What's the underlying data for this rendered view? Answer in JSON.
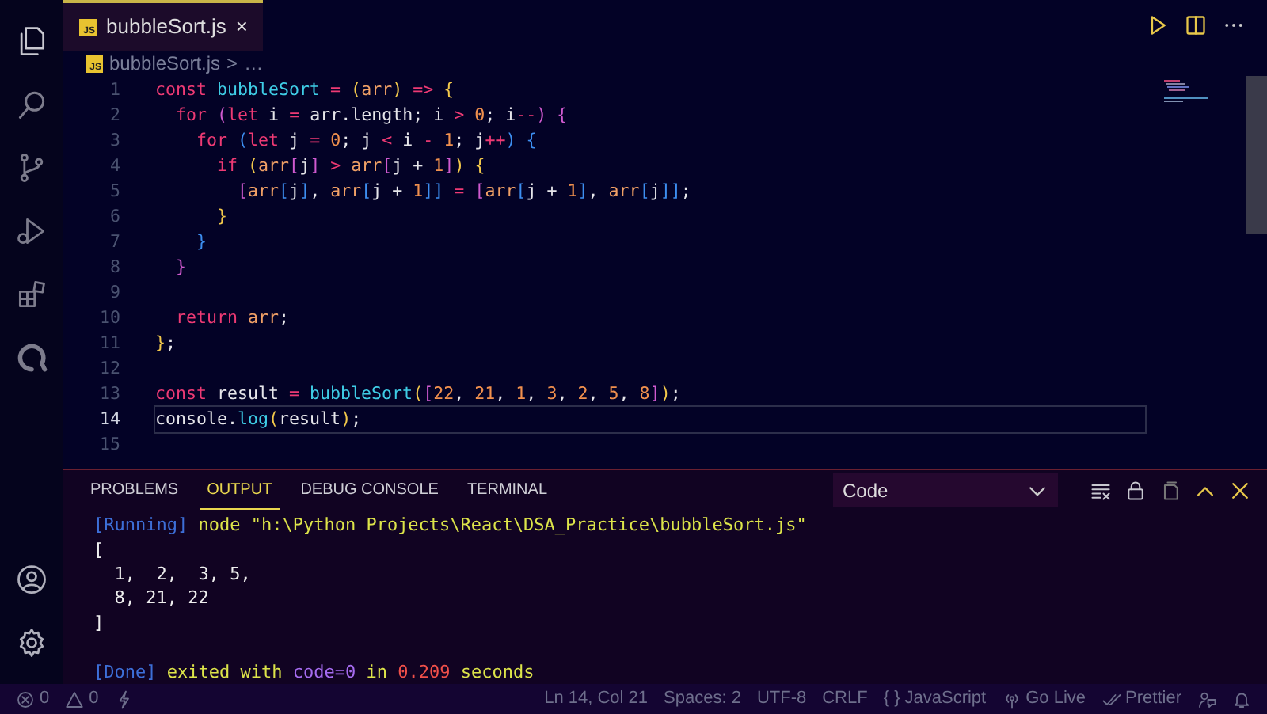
{
  "activity_bar": {
    "top": [
      {
        "kind": "files",
        "selected": true
      },
      {
        "kind": "search",
        "selected": false
      },
      {
        "kind": "branch",
        "selected": false
      },
      {
        "kind": "debug",
        "selected": false
      },
      {
        "kind": "extensions",
        "selected": false
      },
      {
        "kind": "quokka",
        "selected": false
      }
    ],
    "bottom": [
      {
        "kind": "account"
      },
      {
        "kind": "gear"
      }
    ]
  },
  "tabs": [
    {
      "badge": "JS",
      "label": "bubbleSort.js",
      "close": "×",
      "selected": true
    }
  ],
  "editor_actions": [
    {
      "kind": "run"
    },
    {
      "kind": "split"
    },
    {
      "kind": "more"
    }
  ],
  "breadcrumb": {
    "badge": "JS",
    "file": "bubbleSort.js",
    "separator": ">",
    "rest": "…"
  },
  "code": [
    {
      "number": "1",
      "current": false,
      "tokens": [
        {
          "text": "const ",
          "kind": "kw"
        },
        {
          "text": "bubbleSort",
          "kind": "fn"
        },
        {
          "text": " = ",
          "kind": "op"
        },
        {
          "text": "(",
          "kind": "b1"
        },
        {
          "text": "arr",
          "kind": "param"
        },
        {
          "text": ")",
          "kind": "b1"
        },
        {
          "text": " => ",
          "kind": "op"
        },
        {
          "text": "{",
          "kind": "b1"
        }
      ]
    },
    {
      "number": "2",
      "current": false,
      "tokens": [
        {
          "text": "  for ",
          "kind": "kw"
        },
        {
          "text": "(",
          "kind": "b2"
        },
        {
          "text": "let ",
          "kind": "kw"
        },
        {
          "text": "i ",
          "kind": "text"
        },
        {
          "text": "= ",
          "kind": "op"
        },
        {
          "text": "arr.length; i ",
          "kind": "text"
        },
        {
          "text": "> ",
          "kind": "op"
        },
        {
          "text": "0",
          "kind": "num"
        },
        {
          "text": "; i",
          "kind": "text"
        },
        {
          "text": "--",
          "kind": "op"
        },
        {
          "text": ")",
          "kind": "b2"
        },
        {
          "text": " {",
          "kind": "b2"
        }
      ]
    },
    {
      "number": "3",
      "current": false,
      "tokens": [
        {
          "text": "    for ",
          "kind": "kw"
        },
        {
          "text": "(",
          "kind": "b3"
        },
        {
          "text": "let ",
          "kind": "kw"
        },
        {
          "text": "j ",
          "kind": "text"
        },
        {
          "text": "= ",
          "kind": "op"
        },
        {
          "text": "0",
          "kind": "num"
        },
        {
          "text": "; j ",
          "kind": "text"
        },
        {
          "text": "< ",
          "kind": "op"
        },
        {
          "text": "i ",
          "kind": "text"
        },
        {
          "text": "- ",
          "kind": "op"
        },
        {
          "text": "1",
          "kind": "num"
        },
        {
          "text": "; j",
          "kind": "text"
        },
        {
          "text": "++",
          "kind": "op"
        },
        {
          "text": ")",
          "kind": "b3"
        },
        {
          "text": " {",
          "kind": "b3"
        }
      ]
    },
    {
      "number": "4",
      "current": false,
      "tokens": [
        {
          "text": "      if ",
          "kind": "kw"
        },
        {
          "text": "(",
          "kind": "b1"
        },
        {
          "text": "arr",
          "kind": "param"
        },
        {
          "text": "[",
          "kind": "b2"
        },
        {
          "text": "j",
          "kind": "text"
        },
        {
          "text": "]",
          "kind": "b2"
        },
        {
          "text": " > ",
          "kind": "op"
        },
        {
          "text": "arr",
          "kind": "param"
        },
        {
          "text": "[",
          "kind": "b2"
        },
        {
          "text": "j + ",
          "kind": "text"
        },
        {
          "text": "1",
          "kind": "num"
        },
        {
          "text": "]",
          "kind": "b2"
        },
        {
          "text": ")",
          "kind": "b1"
        },
        {
          "text": " {",
          "kind": "b1"
        }
      ]
    },
    {
      "number": "5",
      "current": false,
      "tokens": [
        {
          "text": "        [",
          "kind": "b2"
        },
        {
          "text": "arr",
          "kind": "param"
        },
        {
          "text": "[",
          "kind": "b3"
        },
        {
          "text": "j",
          "kind": "text"
        },
        {
          "text": "]",
          "kind": "b3"
        },
        {
          "text": ", ",
          "kind": "text"
        },
        {
          "text": "arr",
          "kind": "param"
        },
        {
          "text": "[",
          "kind": "b3"
        },
        {
          "text": "j + ",
          "kind": "text"
        },
        {
          "text": "1",
          "kind": "num"
        },
        {
          "text": "]]",
          "kind": "b3"
        },
        {
          "text": " = ",
          "kind": "op"
        },
        {
          "text": "[",
          "kind": "b2"
        },
        {
          "text": "arr",
          "kind": "param"
        },
        {
          "text": "[",
          "kind": "b3"
        },
        {
          "text": "j + ",
          "kind": "text"
        },
        {
          "text": "1",
          "kind": "num"
        },
        {
          "text": "]",
          "kind": "b3"
        },
        {
          "text": ", ",
          "kind": "text"
        },
        {
          "text": "arr",
          "kind": "param"
        },
        {
          "text": "[",
          "kind": "b3"
        },
        {
          "text": "j",
          "kind": "text"
        },
        {
          "text": "]]",
          "kind": "b3"
        },
        {
          "text": ";",
          "kind": "text"
        }
      ]
    },
    {
      "number": "6",
      "current": false,
      "tokens": [
        {
          "text": "      }",
          "kind": "b1"
        }
      ]
    },
    {
      "number": "7",
      "current": false,
      "tokens": [
        {
          "text": "    }",
          "kind": "b3"
        }
      ]
    },
    {
      "number": "8",
      "current": false,
      "tokens": [
        {
          "text": "  }",
          "kind": "b2"
        }
      ]
    },
    {
      "number": "9",
      "current": false
    },
    {
      "number": "10",
      "current": false,
      "tokens": [
        {
          "text": "  return ",
          "kind": "kw"
        },
        {
          "text": "arr",
          "kind": "param"
        },
        {
          "text": ";",
          "kind": "text"
        }
      ]
    },
    {
      "number": "11",
      "current": false,
      "tokens": [
        {
          "text": "}",
          "kind": "b1"
        },
        {
          "text": ";",
          "kind": "text"
        }
      ]
    },
    {
      "number": "12",
      "current": false
    },
    {
      "number": "13",
      "current": false,
      "tokens": [
        {
          "text": "const ",
          "kind": "kw"
        },
        {
          "text": "result ",
          "kind": "text"
        },
        {
          "text": "= ",
          "kind": "op"
        },
        {
          "text": "bubbleSort",
          "kind": "fn"
        },
        {
          "text": "(",
          "kind": "b1"
        },
        {
          "text": "[",
          "kind": "b2"
        },
        {
          "text": "22",
          "kind": "num"
        },
        {
          "text": ", ",
          "kind": "text"
        },
        {
          "text": "21",
          "kind": "num"
        },
        {
          "text": ", ",
          "kind": "text"
        },
        {
          "text": "1",
          "kind": "num"
        },
        {
          "text": ", ",
          "kind": "text"
        },
        {
          "text": "3",
          "kind": "num"
        },
        {
          "text": ", ",
          "kind": "text"
        },
        {
          "text": "2",
          "kind": "num"
        },
        {
          "text": ", ",
          "kind": "text"
        },
        {
          "text": "5",
          "kind": "num"
        },
        {
          "text": ", ",
          "kind": "text"
        },
        {
          "text": "8",
          "kind": "num"
        },
        {
          "text": "]",
          "kind": "b2"
        },
        {
          "text": ")",
          "kind": "b1"
        },
        {
          "text": ";",
          "kind": "text"
        }
      ]
    },
    {
      "number": "14",
      "current": true,
      "tokens": [
        {
          "text": "console.",
          "kind": "text"
        },
        {
          "text": "log",
          "kind": "fn"
        },
        {
          "text": "(",
          "kind": "b1"
        },
        {
          "text": "result",
          "kind": "text"
        },
        {
          "text": ")",
          "kind": "b1"
        },
        {
          "text": ";",
          "kind": "text"
        }
      ]
    },
    {
      "number": "15",
      "current": false
    }
  ],
  "panel": {
    "tabs": [
      {
        "label": "PROBLEMS",
        "selected": false
      },
      {
        "label": "OUTPUT",
        "selected": true
      },
      {
        "label": "DEBUG CONSOLE",
        "selected": false
      },
      {
        "label": "TERMINAL",
        "selected": false
      }
    ],
    "channel": "Code",
    "actions": [
      {
        "kind": "clear"
      },
      {
        "kind": "lock"
      },
      {
        "kind": "copy"
      },
      {
        "kind": "maximize"
      },
      {
        "kind": "close"
      }
    ],
    "output": [
      {
        "tokens": [
          {
            "text": "[Running] ",
            "kind": "tag"
          },
          {
            "text": "node \"h:\\Python Projects\\React\\DSA_Practice\\bubbleSort.js\"",
            "kind": "msg"
          }
        ]
      },
      {
        "tokens": [
          {
            "text": "[",
            "kind": "plain"
          }
        ]
      },
      {
        "tokens": [
          {
            "text": "  1,  2,  3, 5,",
            "kind": "plain"
          }
        ]
      },
      {
        "tokens": [
          {
            "text": "  8, 21, 22",
            "kind": "plain"
          }
        ]
      },
      {
        "tokens": [
          {
            "text": "]",
            "kind": "plain"
          }
        ]
      },
      {
        "gap_before": true,
        "tokens": [
          {
            "text": "[Done] ",
            "kind": "tag"
          },
          {
            "text": "exited with ",
            "kind": "msg"
          },
          {
            "text": "code=0",
            "kind": "code"
          },
          {
            "text": " in ",
            "kind": "msg"
          },
          {
            "text": "0.209",
            "kind": "time"
          },
          {
            "text": " seconds",
            "kind": "msg"
          }
        ]
      }
    ]
  },
  "status_bar": {
    "left": [
      {
        "kind": "error",
        "text": "0"
      },
      {
        "kind": "warning",
        "text": "0"
      },
      {
        "kind": "bolt"
      }
    ],
    "right": [
      {
        "text": "Ln 14, Col 21"
      },
      {
        "text": "Spaces: 2"
      },
      {
        "text": "UTF-8"
      },
      {
        "text": "CRLF"
      },
      {
        "glyph": "{ }",
        "text": "JavaScript"
      },
      {
        "kind": "broadcast",
        "text": "Go Live"
      },
      {
        "kind": "checks",
        "text": "Prettier"
      },
      {
        "kind": "feedback"
      },
      {
        "kind": "bell"
      }
    ]
  }
}
